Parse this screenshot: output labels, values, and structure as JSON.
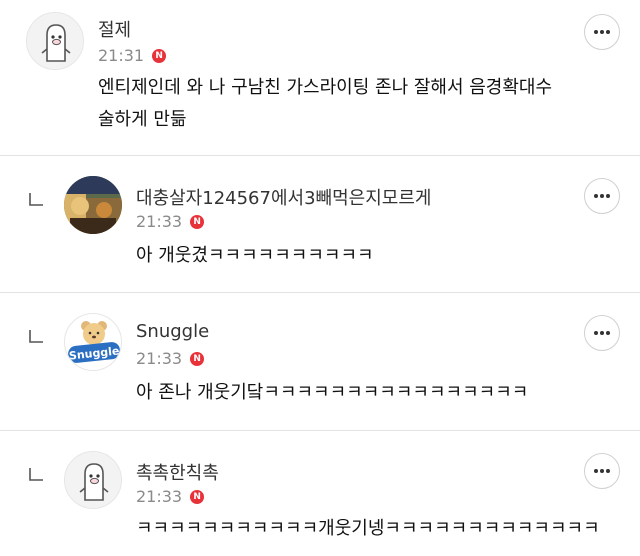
{
  "comments": [
    {
      "author": "절제",
      "time": "21:31",
      "new_badge": "N",
      "lines": [
        "엔티제인데 와 나 구남친 가스라이팅 존나 잘해서 음경확대수",
        "술하게 만듦"
      ],
      "avatar_icon": "mascot-avatar"
    },
    {
      "author": "대충살자124567에서3빼먹은지모르게",
      "time": "21:33",
      "new_badge": "N",
      "lines": [
        "아 개웃겼ㅋㅋㅋㅋㅋㅋㅋㅋㅋㅋ"
      ],
      "avatar_icon": "photo-avatar"
    },
    {
      "author": "Snuggle",
      "time": "21:33",
      "new_badge": "N",
      "lines": [
        "아 존나 개웃기닼ㅋㅋㅋㅋㅋㅋㅋㅋㅋㅋㅋㅋㅋㅋㅋㅋ"
      ],
      "avatar_icon": "snuggle-bear-avatar",
      "avatar_logo_text": "Snuggle"
    },
    {
      "author": "촉촉한칙촉",
      "time": "21:33",
      "new_badge": "N",
      "lines": [
        "ㅋㅋㅋㅋㅋㅋㅋㅋㅋㅋㅋ개웃기넹ㅋㅋㅋㅋㅋㅋㅋㅋㅋㅋㅋㅋㅋ"
      ],
      "avatar_icon": "mascot-avatar"
    }
  ],
  "icons": {
    "more": "more-horizontal-icon",
    "reply": "reply-indent-icon",
    "new": "new-badge-icon"
  },
  "colors": {
    "badge": "#e8323a",
    "divider": "#e3e3e3",
    "meta": "#8a8a8a"
  }
}
